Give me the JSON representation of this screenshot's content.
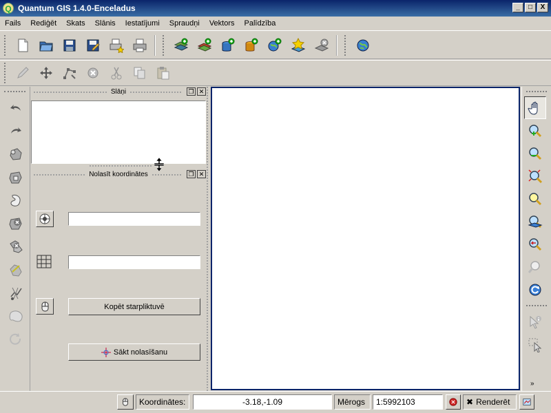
{
  "window": {
    "title": "Quantum GIS 1.4.0-Enceladus",
    "logo_letter": "Q",
    "minimize": "_",
    "maximize": "□",
    "close": "X"
  },
  "menubar": {
    "items": [
      "Fails",
      "Rediģēt",
      "Skats",
      "Slānis",
      "Iestatījumi",
      "Spraudņi",
      "Vektors",
      "Palīdzība"
    ]
  },
  "toolbar_file": {
    "icons": [
      "new-project-icon",
      "open-project-icon",
      "save-project-icon",
      "save-as-icon",
      "new-print-composer-icon",
      "print-icon"
    ]
  },
  "toolbar_layers": {
    "icons": [
      "add-vector-layer-icon",
      "add-raster-layer-icon",
      "add-postgis-layer-icon",
      "add-spatialite-layer-icon",
      "add-wms-layer-icon",
      "new-shapefile-icon",
      "remove-layer-icon"
    ]
  },
  "toolbar_plugins": {
    "icons": [
      "globe-icon"
    ]
  },
  "toolbar_edit": {
    "icons": [
      "toggle-editing-icon",
      "move-feature-icon",
      "node-tool-icon",
      "delete-selected-icon",
      "cut-features-icon",
      "copy-features-icon",
      "paste-features-icon"
    ]
  },
  "left_toolbar": {
    "icons": [
      "undo-icon",
      "redo-icon",
      "simplify-feature-icon",
      "add-ring-icon",
      "add-island-icon",
      "delete-ring-icon",
      "delete-part-icon",
      "reshape-features-icon",
      "split-features-icon",
      "merge-features-icon",
      "rotate-point-symbols-icon"
    ]
  },
  "layers_panel": {
    "title": "Slāņi",
    "float_btn": "❐",
    "close_btn": "✕"
  },
  "coord_panel": {
    "title": "Nolasīt koordinātes",
    "float_btn": "❐",
    "close_btn": "✕",
    "field1_value": "",
    "field2_value": "",
    "copy_button": "Kopēt starpliktuvē",
    "start_button": "Sākt nolasīšanu"
  },
  "right_toolbar": {
    "icons": [
      "pan-icon",
      "zoom-in-icon",
      "zoom-out-icon",
      "zoom-full-icon",
      "zoom-selection-icon",
      "zoom-layer-icon",
      "zoom-last-icon",
      "zoom-actual-icon",
      "refresh-icon",
      "identify-icon",
      "select-icon"
    ],
    "more": "»"
  },
  "statusbar": {
    "coord_label": "Koordinātes:",
    "coord_value": "-3.18,-1.09",
    "scale_label": "Mērogs",
    "scale_value": "1:5992103",
    "render_label": "Renderēt",
    "render_check": "✖"
  },
  "colors": {
    "titlebar": "#0a246a",
    "face": "#d4d0c8",
    "canvas_border": "#0a246a"
  }
}
